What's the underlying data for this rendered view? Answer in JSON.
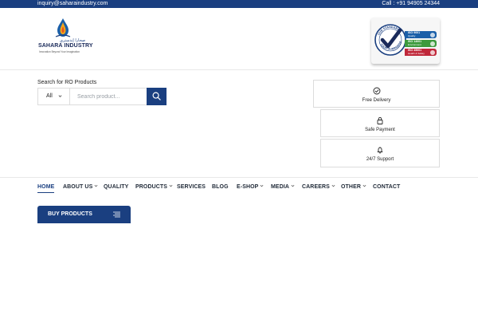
{
  "topbar": {
    "email": "inquiry@saharaindustry.com",
    "phone": "Call : +91 94905 24344"
  },
  "logo": {
    "name": "SAHARA INDUSTRY",
    "arabic": "صحارا إندستري",
    "tagline": "Innovation Beyond Your Imagination",
    "icon": "water-drop-flame-icon"
  },
  "certification_badge": {
    "seal_top": "OUR STANDARD",
    "seal_bottom": "YOUR GUARANTEE",
    "items": [
      {
        "code": "ISO 9001",
        "desc": "Quality",
        "color": "#1a5fa8"
      },
      {
        "code": "ISO 14001",
        "desc": "Environment",
        "color": "#3c9a3c"
      },
      {
        "code": "ISO 45001",
        "desc": "Health & Safety",
        "color": "#c0283a"
      }
    ]
  },
  "search": {
    "label": "Search for RO Products",
    "category": "All",
    "placeholder": "Search product...",
    "button_icon": "search-icon"
  },
  "features": [
    {
      "label": "Free Delivery",
      "icon": "check-circle-icon"
    },
    {
      "label": "Safe Payment",
      "icon": "lock-icon"
    },
    {
      "label": "24/7 Support",
      "icon": "bell-icon"
    }
  ],
  "nav": {
    "items": [
      {
        "label": "HOME",
        "active": true
      },
      {
        "label": "ABOUT US",
        "dropdown": true
      },
      {
        "label": "QUALITY"
      },
      {
        "label": "PRODUCTS",
        "dropdown": true
      },
      {
        "label": "SERVICES"
      },
      {
        "label": "BLOG"
      },
      {
        "label": "E-SHOP",
        "dropdown": true
      },
      {
        "label": "MEDIA",
        "dropdown": true
      },
      {
        "label": "CAREERS",
        "dropdown": true
      },
      {
        "label": "OTHER",
        "dropdown": true
      },
      {
        "label": "CONTACT"
      }
    ]
  },
  "buy_products": {
    "label": "BUY PRODUCTS",
    "icon": "menu-icon"
  },
  "colors": {
    "brand": "#1a3f80",
    "border": "#dcdcdc"
  }
}
